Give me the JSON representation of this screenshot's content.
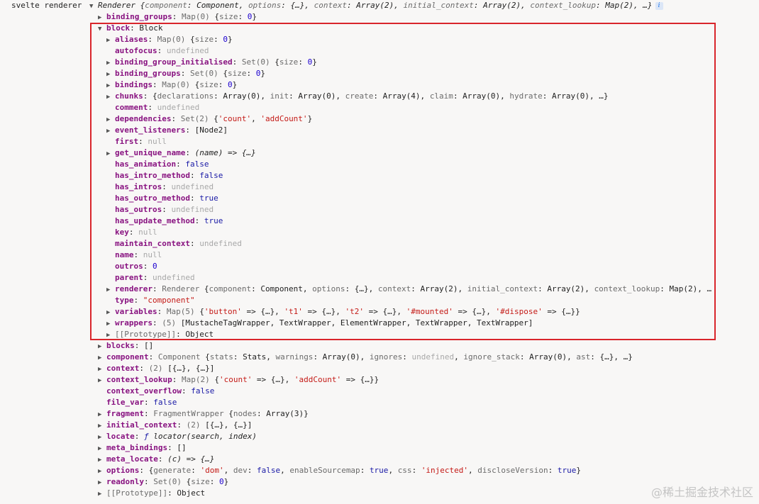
{
  "console_label": "svelte renderer",
  "watermark": "@稀土掘金技术社区",
  "rows": [
    {
      "indent": 0,
      "tri": "open",
      "segs": [
        [
          "it",
          "Renderer "
        ],
        [
          "it",
          "{"
        ],
        [
          "it kp",
          "component"
        ],
        [
          "it",
          ": Component, "
        ],
        [
          "it kp",
          "options"
        ],
        [
          "it",
          ": {…}, "
        ],
        [
          "it kp",
          "context"
        ],
        [
          "it",
          ": Array(2), "
        ],
        [
          "it kp",
          "initial_context"
        ],
        [
          "it",
          ": Array(2), "
        ],
        [
          "it kp",
          "context_lookup"
        ],
        [
          "it",
          ": Map(2), …}"
        ]
      ],
      "info": true
    },
    {
      "indent": 1,
      "tri": "closed",
      "segs": [
        [
          "k",
          "binding_groups"
        ],
        [
          "fn",
          ": "
        ],
        [
          "gray",
          "Map(0) "
        ],
        [
          "fn",
          "{"
        ],
        [
          "kp",
          "size"
        ],
        [
          "fn",
          ": "
        ],
        [
          "num",
          "0"
        ],
        [
          "fn",
          "}"
        ]
      ]
    },
    {
      "indent": 1,
      "tri": "open",
      "segs": [
        [
          "k",
          "block"
        ],
        [
          "fn",
          ": Block"
        ]
      ]
    },
    {
      "indent": 2,
      "tri": "closed",
      "segs": [
        [
          "k",
          "aliases"
        ],
        [
          "fn",
          ": "
        ],
        [
          "gray",
          "Map(0) "
        ],
        [
          "fn",
          "{"
        ],
        [
          "kp",
          "size"
        ],
        [
          "fn",
          ": "
        ],
        [
          "num",
          "0"
        ],
        [
          "fn",
          "}"
        ]
      ]
    },
    {
      "indent": 2,
      "tri": "none",
      "segs": [
        [
          "k",
          "autofocus"
        ],
        [
          "fn",
          ": "
        ],
        [
          "undef",
          "undefined"
        ]
      ]
    },
    {
      "indent": 2,
      "tri": "closed",
      "segs": [
        [
          "k",
          "binding_group_initialised"
        ],
        [
          "fn",
          ": "
        ],
        [
          "gray",
          "Set(0) "
        ],
        [
          "fn",
          "{"
        ],
        [
          "kp",
          "size"
        ],
        [
          "fn",
          ": "
        ],
        [
          "num",
          "0"
        ],
        [
          "fn",
          "}"
        ]
      ]
    },
    {
      "indent": 2,
      "tri": "closed",
      "segs": [
        [
          "k",
          "binding_groups"
        ],
        [
          "fn",
          ": "
        ],
        [
          "gray",
          "Set(0) "
        ],
        [
          "fn",
          "{"
        ],
        [
          "kp",
          "size"
        ],
        [
          "fn",
          ": "
        ],
        [
          "num",
          "0"
        ],
        [
          "fn",
          "}"
        ]
      ]
    },
    {
      "indent": 2,
      "tri": "closed",
      "segs": [
        [
          "k",
          "bindings"
        ],
        [
          "fn",
          ": "
        ],
        [
          "gray",
          "Map(0) "
        ],
        [
          "fn",
          "{"
        ],
        [
          "kp",
          "size"
        ],
        [
          "fn",
          ": "
        ],
        [
          "num",
          "0"
        ],
        [
          "fn",
          "}"
        ]
      ]
    },
    {
      "indent": 2,
      "tri": "closed",
      "segs": [
        [
          "k",
          "chunks"
        ],
        [
          "fn",
          ": {"
        ],
        [
          "kp",
          "declarations"
        ],
        [
          "fn",
          ": Array(0), "
        ],
        [
          "kp",
          "init"
        ],
        [
          "fn",
          ": Array(0), "
        ],
        [
          "kp",
          "create"
        ],
        [
          "fn",
          ": Array(4), "
        ],
        [
          "kp",
          "claim"
        ],
        [
          "fn",
          ": Array(0), "
        ],
        [
          "kp",
          "hydrate"
        ],
        [
          "fn",
          ": Array(0), …}"
        ]
      ]
    },
    {
      "indent": 2,
      "tri": "none",
      "segs": [
        [
          "k",
          "comment"
        ],
        [
          "fn",
          ": "
        ],
        [
          "undef",
          "undefined"
        ]
      ]
    },
    {
      "indent": 2,
      "tri": "closed",
      "segs": [
        [
          "k",
          "dependencies"
        ],
        [
          "fn",
          ": "
        ],
        [
          "gray",
          "Set(2) "
        ],
        [
          "fn",
          "{"
        ],
        [
          "str",
          "'count'"
        ],
        [
          "fn",
          ", "
        ],
        [
          "str",
          "'addCount'"
        ],
        [
          "fn",
          "}"
        ]
      ]
    },
    {
      "indent": 2,
      "tri": "closed",
      "segs": [
        [
          "k",
          "event_listeners"
        ],
        [
          "fn",
          ": [Node2]"
        ]
      ]
    },
    {
      "indent": 2,
      "tri": "none",
      "segs": [
        [
          "k",
          "first"
        ],
        [
          "fn",
          ": "
        ],
        [
          "null",
          "null"
        ]
      ]
    },
    {
      "indent": 2,
      "tri": "closed",
      "segs": [
        [
          "k",
          "get_unique_name"
        ],
        [
          "fn",
          ": "
        ],
        [
          "it",
          "(name) => {…}"
        ]
      ]
    },
    {
      "indent": 2,
      "tri": "none",
      "segs": [
        [
          "k",
          "has_animation"
        ],
        [
          "fn",
          ": "
        ],
        [
          "bool",
          "false"
        ]
      ]
    },
    {
      "indent": 2,
      "tri": "none",
      "segs": [
        [
          "k",
          "has_intro_method"
        ],
        [
          "fn",
          ": "
        ],
        [
          "bool",
          "false"
        ]
      ]
    },
    {
      "indent": 2,
      "tri": "none",
      "segs": [
        [
          "k",
          "has_intros"
        ],
        [
          "fn",
          ": "
        ],
        [
          "undef",
          "undefined"
        ]
      ]
    },
    {
      "indent": 2,
      "tri": "none",
      "segs": [
        [
          "k",
          "has_outro_method"
        ],
        [
          "fn",
          ": "
        ],
        [
          "bool",
          "true"
        ]
      ]
    },
    {
      "indent": 2,
      "tri": "none",
      "segs": [
        [
          "k",
          "has_outros"
        ],
        [
          "fn",
          ": "
        ],
        [
          "undef",
          "undefined"
        ]
      ]
    },
    {
      "indent": 2,
      "tri": "none",
      "segs": [
        [
          "k",
          "has_update_method"
        ],
        [
          "fn",
          ": "
        ],
        [
          "bool",
          "true"
        ]
      ]
    },
    {
      "indent": 2,
      "tri": "none",
      "segs": [
        [
          "k",
          "key"
        ],
        [
          "fn",
          ": "
        ],
        [
          "null",
          "null"
        ]
      ]
    },
    {
      "indent": 2,
      "tri": "none",
      "segs": [
        [
          "k",
          "maintain_context"
        ],
        [
          "fn",
          ": "
        ],
        [
          "undef",
          "undefined"
        ]
      ]
    },
    {
      "indent": 2,
      "tri": "none",
      "segs": [
        [
          "k",
          "name"
        ],
        [
          "fn",
          ": "
        ],
        [
          "null",
          "null"
        ]
      ]
    },
    {
      "indent": 2,
      "tri": "none",
      "segs": [
        [
          "k",
          "outros"
        ],
        [
          "fn",
          ": "
        ],
        [
          "num",
          "0"
        ]
      ]
    },
    {
      "indent": 2,
      "tri": "none",
      "segs": [
        [
          "k",
          "parent"
        ],
        [
          "fn",
          ": "
        ],
        [
          "undef",
          "undefined"
        ]
      ]
    },
    {
      "indent": 2,
      "tri": "closed",
      "segs": [
        [
          "k",
          "renderer"
        ],
        [
          "fn",
          ": "
        ],
        [
          "gray",
          "Renderer "
        ],
        [
          "fn",
          "{"
        ],
        [
          "kp",
          "component"
        ],
        [
          "fn",
          ": Component, "
        ],
        [
          "kp",
          "options"
        ],
        [
          "fn",
          ": {…}, "
        ],
        [
          "kp",
          "context"
        ],
        [
          "fn",
          ": Array(2), "
        ],
        [
          "kp",
          "initial_context"
        ],
        [
          "fn",
          ": Array(2), "
        ],
        [
          "kp",
          "context_lookup"
        ],
        [
          "fn",
          ": Map(2), …"
        ]
      ]
    },
    {
      "indent": 2,
      "tri": "none",
      "segs": [
        [
          "k",
          "type"
        ],
        [
          "fn",
          ": "
        ],
        [
          "str",
          "\"component\""
        ]
      ]
    },
    {
      "indent": 2,
      "tri": "closed",
      "segs": [
        [
          "k",
          "variables"
        ],
        [
          "fn",
          ": "
        ],
        [
          "gray",
          "Map(5) "
        ],
        [
          "fn",
          "{"
        ],
        [
          "str",
          "'button'"
        ],
        [
          "fn",
          " => {…}, "
        ],
        [
          "str",
          "'t1'"
        ],
        [
          "fn",
          " => {…}, "
        ],
        [
          "str",
          "'t2'"
        ],
        [
          "fn",
          " => {…}, "
        ],
        [
          "str",
          "'#mounted'"
        ],
        [
          "fn",
          " => {…}, "
        ],
        [
          "str",
          "'#dispose'"
        ],
        [
          "fn",
          " => {…}}"
        ]
      ]
    },
    {
      "indent": 2,
      "tri": "closed",
      "segs": [
        [
          "k",
          "wrappers"
        ],
        [
          "fn",
          ": "
        ],
        [
          "gray",
          "(5) "
        ],
        [
          "fn",
          "[MustacheTagWrapper, TextWrapper, ElementWrapper, TextWrapper, TextWrapper]"
        ]
      ]
    },
    {
      "indent": 2,
      "tri": "closed",
      "segs": [
        [
          "gray",
          "[[Prototype]]"
        ],
        [
          "fn",
          ": Object"
        ]
      ]
    },
    {
      "indent": 1,
      "tri": "closed",
      "segs": [
        [
          "k",
          "blocks"
        ],
        [
          "fn",
          ": []"
        ]
      ]
    },
    {
      "indent": 1,
      "tri": "closed",
      "segs": [
        [
          "k",
          "component"
        ],
        [
          "fn",
          ": "
        ],
        [
          "gray",
          "Component "
        ],
        [
          "fn",
          "{"
        ],
        [
          "kp",
          "stats"
        ],
        [
          "fn",
          ": Stats, "
        ],
        [
          "kp",
          "warnings"
        ],
        [
          "fn",
          ": Array(0), "
        ],
        [
          "kp",
          "ignores"
        ],
        [
          "fn",
          ": "
        ],
        [
          "undef",
          "undefined"
        ],
        [
          "fn",
          ", "
        ],
        [
          "kp",
          "ignore_stack"
        ],
        [
          "fn",
          ": Array(0), "
        ],
        [
          "kp",
          "ast"
        ],
        [
          "fn",
          ": {…}, …}"
        ]
      ]
    },
    {
      "indent": 1,
      "tri": "closed",
      "segs": [
        [
          "k",
          "context"
        ],
        [
          "fn",
          ": "
        ],
        [
          "gray",
          "(2) "
        ],
        [
          "fn",
          "[{…}, {…}]"
        ]
      ]
    },
    {
      "indent": 1,
      "tri": "closed",
      "segs": [
        [
          "k",
          "context_lookup"
        ],
        [
          "fn",
          ": "
        ],
        [
          "gray",
          "Map(2) "
        ],
        [
          "fn",
          "{"
        ],
        [
          "str",
          "'count'"
        ],
        [
          "fn",
          " => {…}, "
        ],
        [
          "str",
          "'addCount'"
        ],
        [
          "fn",
          " => {…}}"
        ]
      ]
    },
    {
      "indent": 1,
      "tri": "none",
      "segs": [
        [
          "k",
          "context_overflow"
        ],
        [
          "fn",
          ": "
        ],
        [
          "bool",
          "false"
        ]
      ]
    },
    {
      "indent": 1,
      "tri": "none",
      "segs": [
        [
          "k",
          "file_var"
        ],
        [
          "fn",
          ": "
        ],
        [
          "bool",
          "false"
        ]
      ]
    },
    {
      "indent": 1,
      "tri": "closed",
      "segs": [
        [
          "k",
          "fragment"
        ],
        [
          "fn",
          ": "
        ],
        [
          "gray",
          "FragmentWrapper "
        ],
        [
          "fn",
          "{"
        ],
        [
          "kp",
          "nodes"
        ],
        [
          "fn",
          ": Array(3)}"
        ]
      ]
    },
    {
      "indent": 1,
      "tri": "closed",
      "segs": [
        [
          "k",
          "initial_context"
        ],
        [
          "fn",
          ": "
        ],
        [
          "gray",
          "(2) "
        ],
        [
          "fn",
          "[{…}, {…}]"
        ]
      ]
    },
    {
      "indent": 1,
      "tri": "closed",
      "segs": [
        [
          "k",
          "locate"
        ],
        [
          "fn",
          ": "
        ],
        [
          "it bool",
          "ƒ "
        ],
        [
          "it",
          "locator(search, index)"
        ]
      ]
    },
    {
      "indent": 1,
      "tri": "closed",
      "segs": [
        [
          "k",
          "meta_bindings"
        ],
        [
          "fn",
          ": []"
        ]
      ]
    },
    {
      "indent": 1,
      "tri": "closed",
      "segs": [
        [
          "k",
          "meta_locate"
        ],
        [
          "fn",
          ": "
        ],
        [
          "it",
          "(c) => {…}"
        ]
      ]
    },
    {
      "indent": 1,
      "tri": "closed",
      "segs": [
        [
          "k",
          "options"
        ],
        [
          "fn",
          ": {"
        ],
        [
          "kp",
          "generate"
        ],
        [
          "fn",
          ": "
        ],
        [
          "str",
          "'dom'"
        ],
        [
          "fn",
          ", "
        ],
        [
          "kp",
          "dev"
        ],
        [
          "fn",
          ": "
        ],
        [
          "bool",
          "false"
        ],
        [
          "fn",
          ", "
        ],
        [
          "kp",
          "enableSourcemap"
        ],
        [
          "fn",
          ": "
        ],
        [
          "bool",
          "true"
        ],
        [
          "fn",
          ", "
        ],
        [
          "kp",
          "css"
        ],
        [
          "fn",
          ": "
        ],
        [
          "str",
          "'injected'"
        ],
        [
          "fn",
          ", "
        ],
        [
          "kp",
          "discloseVersion"
        ],
        [
          "fn",
          ": "
        ],
        [
          "bool",
          "true"
        ],
        [
          "fn",
          "}"
        ]
      ]
    },
    {
      "indent": 1,
      "tri": "closed",
      "segs": [
        [
          "k",
          "readonly"
        ],
        [
          "fn",
          ": "
        ],
        [
          "gray",
          "Set(0) "
        ],
        [
          "fn",
          "{"
        ],
        [
          "kp",
          "size"
        ],
        [
          "fn",
          ": "
        ],
        [
          "num",
          "0"
        ],
        [
          "fn",
          "}"
        ]
      ]
    },
    {
      "indent": 1,
      "tri": "closed",
      "segs": [
        [
          "gray",
          "[[Prototype]]"
        ],
        [
          "fn",
          ": Object"
        ]
      ]
    }
  ]
}
